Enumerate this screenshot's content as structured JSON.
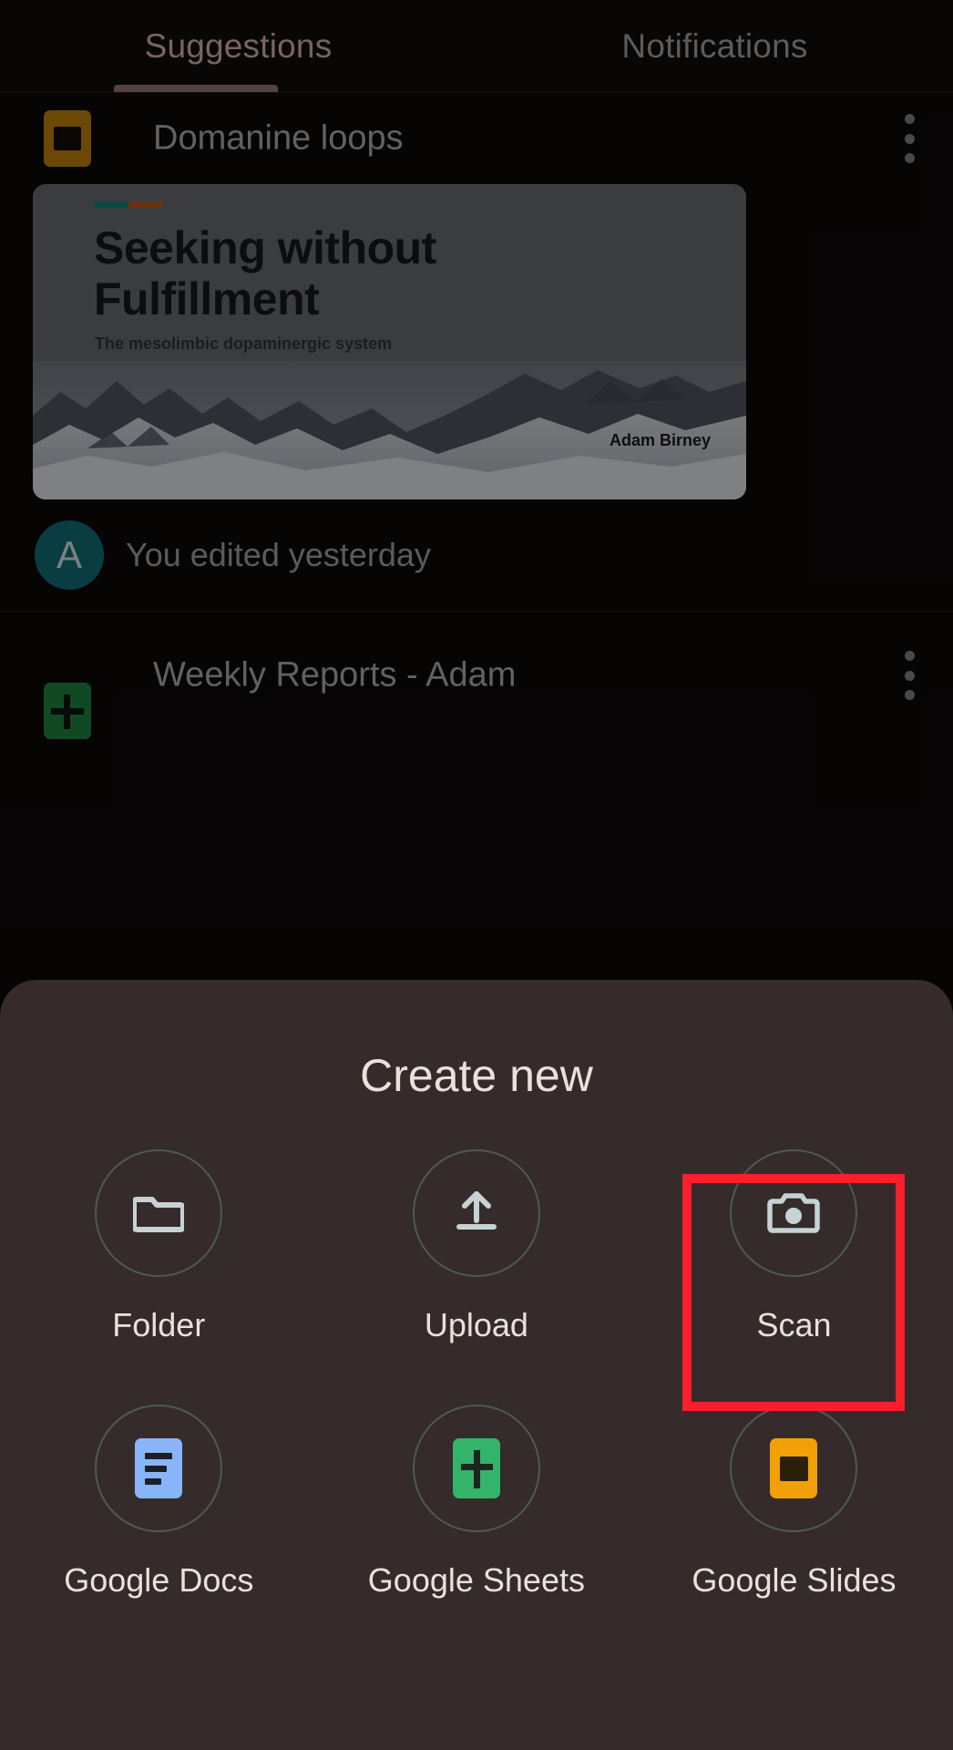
{
  "app": {
    "title": "Create new",
    "theme_bg": "#0b0908",
    "sheet_bg": "#352b2a",
    "accent": "#c6a8a4",
    "highlight_color": "#fb1f2c"
  },
  "tabs": {
    "items": [
      {
        "label": "Suggestions",
        "active": true
      },
      {
        "label": "Notifications",
        "active": false
      }
    ]
  },
  "feed": {
    "items": [
      {
        "title": "Domanine loops",
        "icon": "google-slides-icon",
        "icon_color": "#b2790a",
        "overflow_icon": "kebab-menu-icon",
        "thumbnail": {
          "title": "Seeking without Fulfillment",
          "subtitle": "The mesolimbic dopaminergic system",
          "author": "Adam Birney",
          "accent_colors": [
            "#147a70",
            "#b35719"
          ]
        },
        "activity": {
          "avatar_initial": "A",
          "avatar_color": "#11666e",
          "text": "You edited yesterday"
        }
      },
      {
        "title": "Weekly Reports - Adam",
        "icon": "google-sheets-icon",
        "icon_color": "#1d7a3c",
        "overflow_icon": "kebab-menu-icon"
      }
    ]
  },
  "sheet": {
    "title": "Create new",
    "rows": [
      [
        {
          "label": "Folder",
          "icon": "folder-icon",
          "icon_color": "#c6d2d4",
          "highlighted": false
        },
        {
          "label": "Upload",
          "icon": "upload-icon",
          "icon_color": "#c6d2d4",
          "highlighted": false
        },
        {
          "label": "Scan",
          "icon": "camera-icon",
          "icon_color": "#c6d2d4",
          "highlighted": true
        }
      ],
      [
        {
          "label": "Google Docs",
          "icon": "google-docs-icon",
          "icon_color": "#8ab4f8",
          "highlighted": false
        },
        {
          "label": "Google Sheets",
          "icon": "google-sheets-icon",
          "icon_color": "#34b36b",
          "highlighted": false
        },
        {
          "label": "Google Slides",
          "icon": "google-slides-icon",
          "icon_color": "#f2a007",
          "highlighted": false
        }
      ]
    ]
  }
}
